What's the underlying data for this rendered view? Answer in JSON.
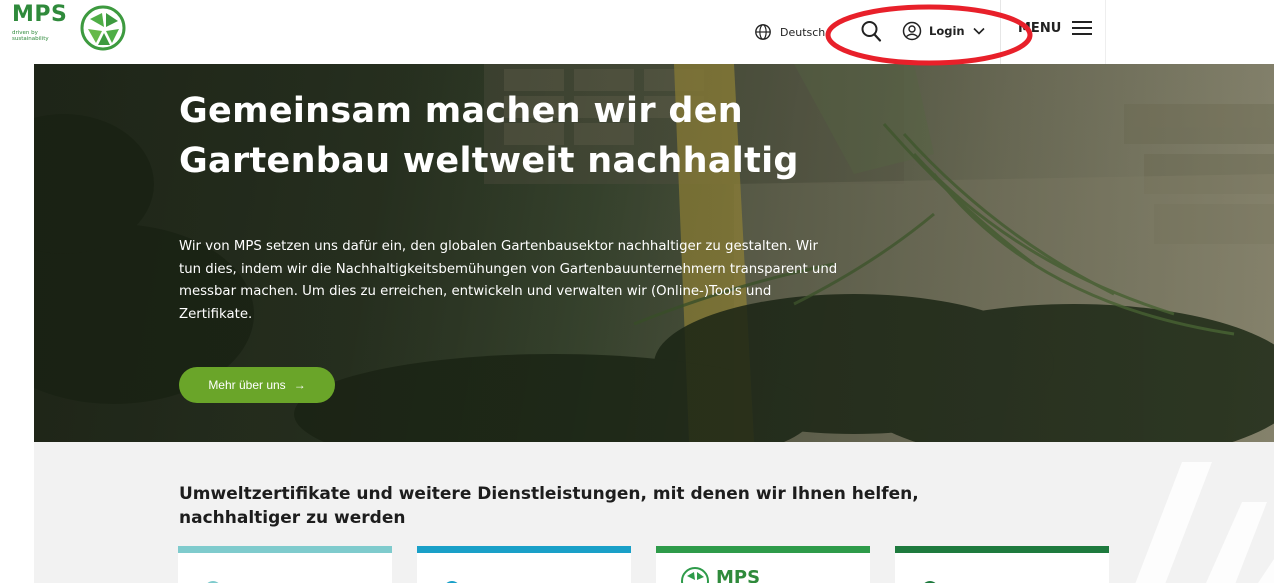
{
  "header": {
    "logo": {
      "brand": "MPS",
      "tagline": "driven by sustainability"
    },
    "language_label": "Deutsch",
    "login_label": "Login",
    "menu_label": "MENU"
  },
  "hero": {
    "title": "Gemeinsam machen wir den Gartenbau weltweit nachhaltig",
    "text": "Wir von MPS setzen uns dafür ein, den globalen Gartenbausektor nachhaltiger zu gestalten. Wir tun dies, indem wir die Nachhaltigkeitsbemühungen von Gartenbauunternehmern transparent und messbar machen. Um dies zu erreichen, entwickeln und verwalten wir (Online-)Tools und Zertifikate.",
    "button_label": "Mehr über uns",
    "button_arrow": "→"
  },
  "services": {
    "title": "Umweltzertifikate und weitere Dienstleistungen, mit denen wir Ihnen helfen, nachhaltiger zu werden",
    "cards": [
      {
        "accent": "#7fcbcd"
      },
      {
        "accent": "#1aa0c8"
      },
      {
        "accent": "#2e9b4a",
        "label": "MPS"
      },
      {
        "accent": "#1e7a3e"
      }
    ]
  },
  "colors": {
    "brand_green": "#2f8a3b",
    "button_green": "#6aa529",
    "annotation_red": "#e8202a"
  }
}
